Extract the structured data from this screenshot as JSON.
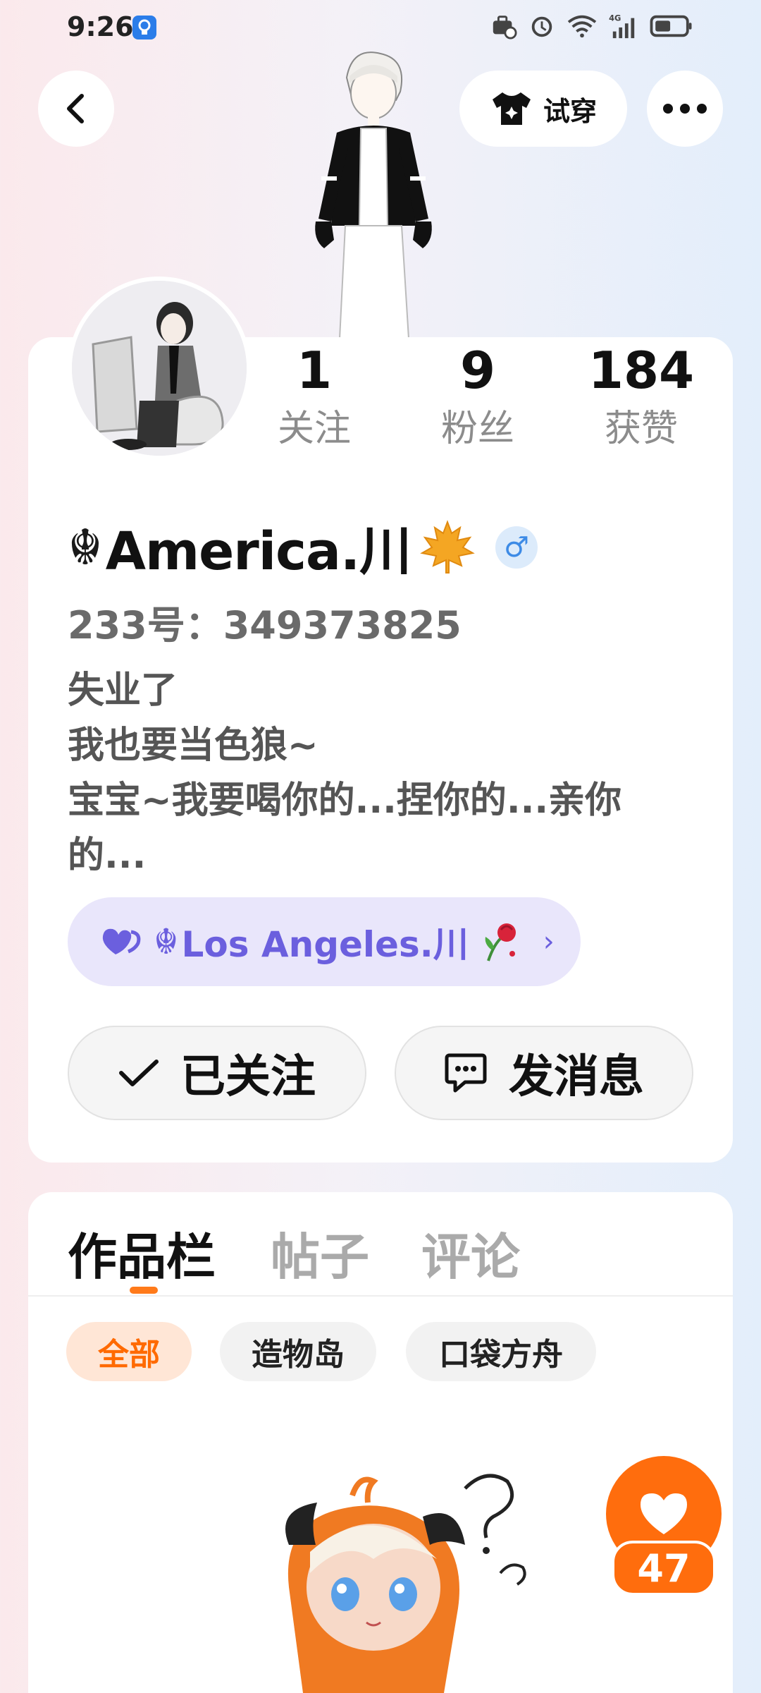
{
  "status_bar": {
    "time": "9:26",
    "network": "4G",
    "icons": [
      "lightbulb-notification-icon",
      "briefcase-icon",
      "alarm-icon",
      "wifi-icon",
      "signal-icon",
      "battery-icon"
    ]
  },
  "header": {
    "back_icon": "chevron-left-icon",
    "try_on_label": "试穿",
    "try_on_icon": "tshirt-icon",
    "more_icon": "more-dots-icon"
  },
  "profile": {
    "stats": [
      {
        "value": "1",
        "label": "关注"
      },
      {
        "value": "9",
        "label": "粉丝"
      },
      {
        "value": "184",
        "label": "获赞"
      }
    ],
    "username_symbol": "☬",
    "username": "America.川",
    "username_emoji": "🍁",
    "gender_symbol": "♂",
    "id_line": "233号：349373825",
    "bio": "失业了\n我也要当色狼~\n宝宝~我要喝你的...捏你的...亲你的...",
    "partner": {
      "symbol": "☬",
      "name": "Los Angeles.川",
      "emoji": "🥀",
      "chevron": "›"
    },
    "follow_button": "已关注",
    "message_button": "发消息"
  },
  "works": {
    "tabs": [
      "作品栏",
      "帖子",
      "评论"
    ],
    "active_tab": 0,
    "filters": [
      "全部",
      "造物岛",
      "口袋方舟"
    ],
    "active_filter": 0,
    "like_count": "47"
  },
  "colors": {
    "accent": "#ff6d0d",
    "partner_text": "#6b5fde",
    "partner_bg": "#e9e6fb",
    "gender_blue": "#3d8be6"
  }
}
